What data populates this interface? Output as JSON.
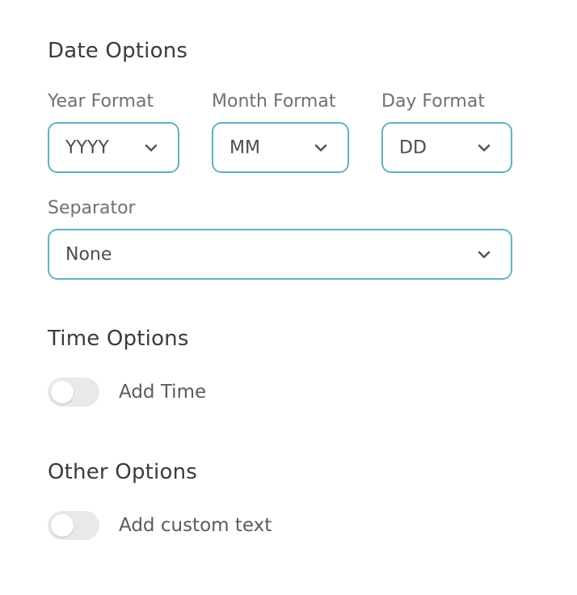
{
  "date_options": {
    "title": "Date Options",
    "year": {
      "label": "Year Format",
      "value": "YYYY"
    },
    "month": {
      "label": "Month Format",
      "value": "MM"
    },
    "day": {
      "label": "Day Format",
      "value": "DD"
    },
    "separator": {
      "label": "Separator",
      "value": "None"
    }
  },
  "time_options": {
    "title": "Time Options",
    "add_time": {
      "label": "Add Time",
      "enabled": false
    }
  },
  "other_options": {
    "title": "Other Options",
    "add_custom_text": {
      "label": "Add custom text",
      "enabled": false
    }
  },
  "colors": {
    "select_border": "#5db3c4",
    "toggle_off": "#e9e9ea",
    "title_text": "#3b3b3d",
    "label_text": "#6f7075"
  },
  "icons": {
    "dropdown": "chevron-down-icon"
  }
}
